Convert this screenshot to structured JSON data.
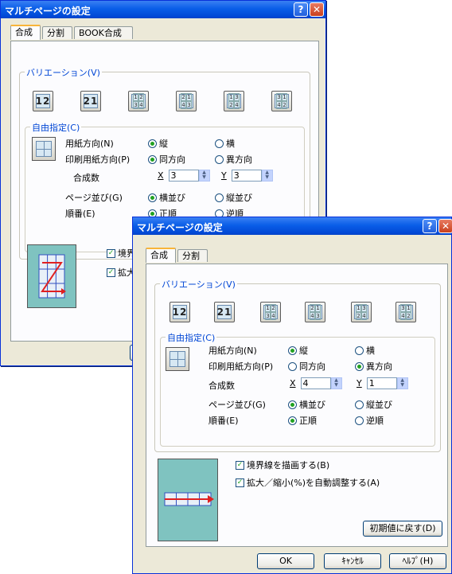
{
  "dialog_back": {
    "title": "マルチページの設定",
    "tabs": [
      "合成",
      "分割",
      "BOOK合成"
    ],
    "variation": {
      "label": "バリエーション(V)",
      "buttons": [
        {
          "type": "big",
          "text": "12"
        },
        {
          "type": "big",
          "text": "21"
        },
        {
          "type": "grid",
          "cells": [
            "1",
            "2",
            "3",
            "4"
          ]
        },
        {
          "type": "grid",
          "cells": [
            "2",
            "1",
            "4",
            "3"
          ]
        },
        {
          "type": "grid",
          "cells": [
            "1",
            "3",
            "2",
            "4"
          ]
        },
        {
          "type": "grid",
          "cells": [
            "3",
            "1",
            "4",
            "2"
          ]
        }
      ]
    },
    "free": {
      "label": "自由指定(C)",
      "paper_orient": {
        "label": "用紙方向(N)",
        "opt1": "縦",
        "opt2": "横",
        "selected": 1
      },
      "print_orient": {
        "label": "印刷用紙方向(P)",
        "opt1": "同方向",
        "opt2": "異方向",
        "selected": 1
      },
      "combine": {
        "label": "合成数",
        "x_label": "X",
        "x_value": "3",
        "y_label": "Y",
        "y_value": "3"
      },
      "page_order": {
        "label": "ページ並び(G)",
        "opt1": "横並び",
        "opt2": "縦並び",
        "selected": 1
      },
      "sequence": {
        "label": "順番(E)",
        "opt1": "正順",
        "opt2": "逆順",
        "selected": 1
      }
    },
    "checks": {
      "border_partial": "境界",
      "scale_partial": "拡大"
    }
  },
  "dialog_front": {
    "title": "マルチページの設定",
    "tabs": [
      "合成",
      "分割"
    ],
    "variation": {
      "label": "バリエーション(V)",
      "buttons": [
        {
          "type": "big",
          "text": "12"
        },
        {
          "type": "big",
          "text": "21"
        },
        {
          "type": "grid",
          "cells": [
            "1",
            "2",
            "3",
            "4"
          ]
        },
        {
          "type": "grid",
          "cells": [
            "2",
            "1",
            "4",
            "3"
          ]
        },
        {
          "type": "grid",
          "cells": [
            "1",
            "3",
            "2",
            "4"
          ]
        },
        {
          "type": "grid",
          "cells": [
            "3",
            "1",
            "4",
            "2"
          ]
        }
      ]
    },
    "free": {
      "label": "自由指定(C)",
      "paper_orient": {
        "label": "用紙方向(N)",
        "opt1": "縦",
        "opt2": "横",
        "selected": 1
      },
      "print_orient": {
        "label": "印刷用紙方向(P)",
        "opt1": "同方向",
        "opt2": "異方向",
        "selected": 2
      },
      "combine": {
        "label": "合成数",
        "x_label": "X",
        "x_value": "4",
        "y_label": "Y",
        "y_value": "1"
      },
      "page_order": {
        "label": "ページ並び(G)",
        "opt1": "横並び",
        "opt2": "縦並び",
        "selected": 1
      },
      "sequence": {
        "label": "順番(E)",
        "opt1": "正順",
        "opt2": "逆順",
        "selected": 1
      }
    },
    "checks": {
      "border": "境界線を描画する(B)",
      "scale": "拡大／縮小(%)を自動調整する(A)"
    },
    "reset_button": "初期値に戻す(D)",
    "ok_button": "OK",
    "cancel_button": "ｷｬﾝｾﾙ",
    "help_button": "ﾍﾙﾌﾟ(H)"
  },
  "colors": {
    "title_bar": "#0A5EE8",
    "accent_label": "#0046D5",
    "preview_bg": "#7FC3C0",
    "check_mark": "#21A121"
  }
}
